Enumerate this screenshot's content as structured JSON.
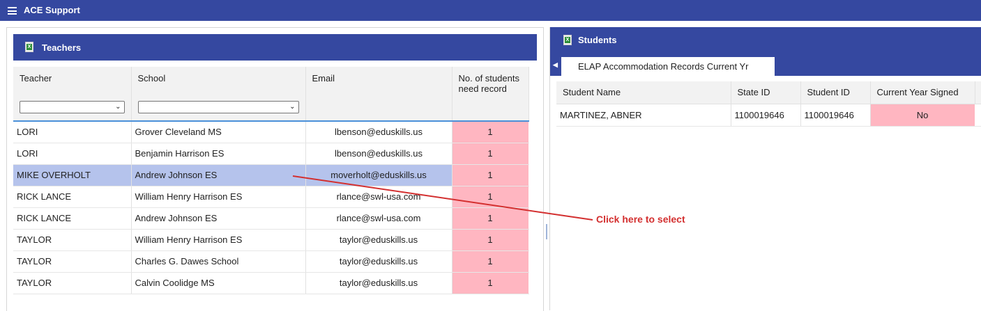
{
  "app": {
    "title": "ACE Support"
  },
  "teachers": {
    "title": "Teachers",
    "columns": [
      "Teacher",
      "School",
      "Email",
      "No. of students need record"
    ],
    "rows": [
      {
        "teacher": "LORI",
        "school": "Grover Cleveland MS",
        "email": "lbenson@eduskills.us",
        "count": "1"
      },
      {
        "teacher": "LORI",
        "school": "Benjamin Harrison ES",
        "email": "lbenson@eduskills.us",
        "count": "1"
      },
      {
        "teacher": "MIKE OVERHOLT",
        "school": "Andrew Johnson ES",
        "email": "moverholt@eduskills.us",
        "count": "1"
      },
      {
        "teacher": "RICK LANCE",
        "school": "William Henry Harrison ES",
        "email": "rlance@swl-usa.com",
        "count": "1"
      },
      {
        "teacher": "RICK LANCE",
        "school": "Andrew Johnson ES",
        "email": "rlance@swl-usa.com",
        "count": "1"
      },
      {
        "teacher": "TAYLOR",
        "school": "William Henry Harrison ES",
        "email": "taylor@eduskills.us",
        "count": "1"
      },
      {
        "teacher": "TAYLOR",
        "school": "Charles G. Dawes School",
        "email": "taylor@eduskills.us",
        "count": "1"
      },
      {
        "teacher": "TAYLOR",
        "school": "Calvin Coolidge MS",
        "email": "taylor@eduskills.us",
        "count": "1"
      }
    ],
    "filters": {
      "teacher": "",
      "school": ""
    }
  },
  "students": {
    "title": "Students",
    "tab_label": "ELAP Accommodation Records Current Yr",
    "columns": [
      "Student Name",
      "State ID",
      "Student ID",
      "Current Year Signed"
    ],
    "rows": [
      {
        "name": "MARTINEZ, ABNER",
        "state_id": "1100019646",
        "student_id": "1100019646",
        "signed": "No"
      }
    ]
  },
  "annotation": {
    "text": "Click here to select",
    "color": "#d32f2f"
  },
  "colors": {
    "header": "#3548a0",
    "count_cell": "#ffb6c1",
    "selected_row": "#b5c3ec"
  }
}
